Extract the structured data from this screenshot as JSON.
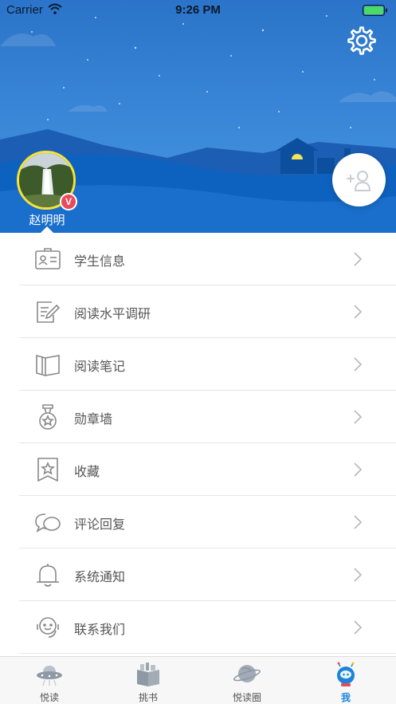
{
  "status_bar": {
    "carrier": "Carrier",
    "time": "9:26 PM"
  },
  "profile": {
    "name": "赵明明",
    "badge": "V"
  },
  "menu": {
    "items": [
      {
        "label": "学生信息",
        "icon": "student-id-card-icon"
      },
      {
        "label": "阅读水平调研",
        "icon": "survey-edit-icon"
      },
      {
        "label": "阅读笔记",
        "icon": "open-book-icon"
      },
      {
        "label": "勋章墙",
        "icon": "medal-icon"
      },
      {
        "label": "收藏",
        "icon": "bookmark-star-icon"
      },
      {
        "label": "评论回复",
        "icon": "chat-bubbles-icon"
      },
      {
        "label": "系统通知",
        "icon": "bell-icon"
      },
      {
        "label": "联系我们",
        "icon": "customer-service-icon"
      }
    ]
  },
  "tabbar": {
    "tabs": [
      {
        "label": "悦读",
        "icon": "ufo-icon",
        "active": false
      },
      {
        "label": "挑书",
        "icon": "books-icon",
        "active": false
      },
      {
        "label": "悦读圈",
        "icon": "planet-icon",
        "active": false
      },
      {
        "label": "我",
        "icon": "astronaut-icon",
        "active": true
      }
    ]
  },
  "colors": {
    "accent": "#1d84d8",
    "hero_sky": "#2b74c9",
    "badge": "#e94b5b",
    "avatar_ring": "#f5e23a",
    "battery": "#4cd964"
  }
}
